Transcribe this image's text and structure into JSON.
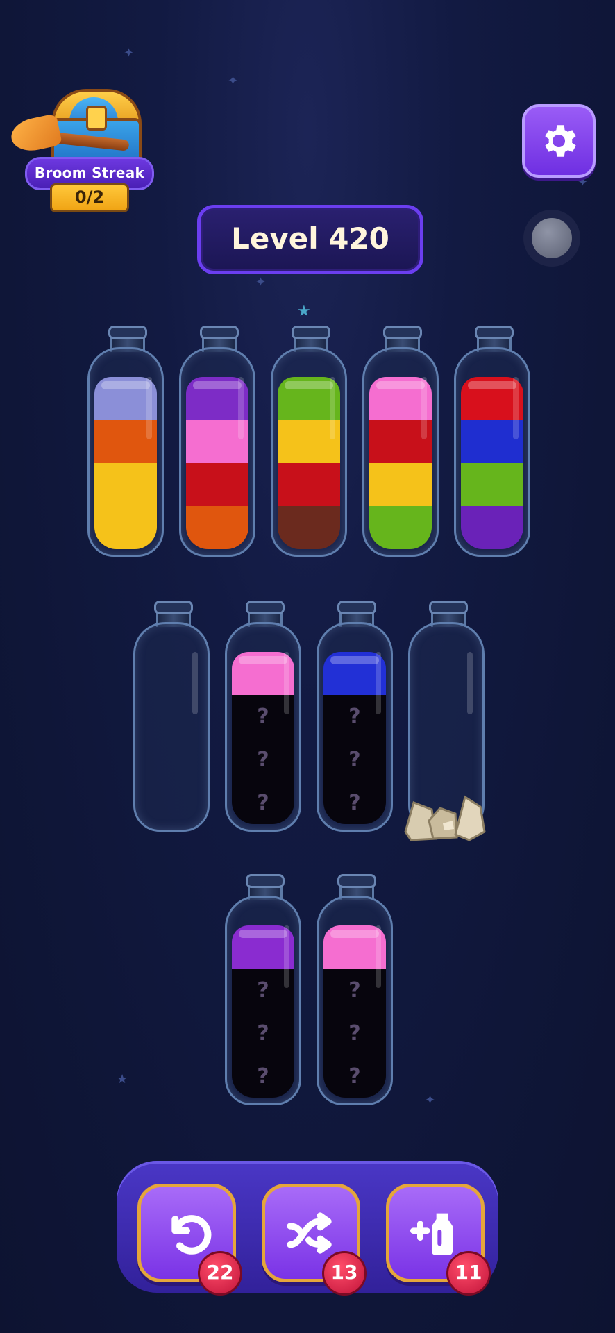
{
  "header": {
    "streak_label": "Broom Streak",
    "streak_count": "0/2",
    "settings_icon": "gear-icon",
    "record_icon": "record-icon",
    "level_text": "Level 420"
  },
  "tubes": [
    {
      "layers": [
        "#f5c21a",
        "#f5c21a",
        "#e0560e",
        "#8b8fd8"
      ],
      "hidden": 0
    },
    {
      "layers": [
        "#e0560e",
        "#c8101a",
        "#f56ed0",
        "#7d2cc6"
      ],
      "hidden": 0
    },
    {
      "layers": [
        "#6b2a1e",
        "#c8101a",
        "#f5c21a",
        "#66b51c"
      ],
      "hidden": 0
    },
    {
      "layers": [
        "#66b51c",
        "#f5c21a",
        "#c8101a",
        "#f56ed0"
      ],
      "hidden": 0
    },
    {
      "layers": [
        "#6a22b8",
        "#66b51c",
        "#1f2ed0",
        "#d8101c"
      ],
      "hidden": 0
    },
    {
      "layers": [],
      "hidden": 0
    },
    {
      "layers": [
        "#f56ed0"
      ],
      "hidden": 3
    },
    {
      "layers": [
        "#2230d6"
      ],
      "hidden": 3
    },
    {
      "layers": [],
      "hidden": 0
    },
    {
      "layers": [
        "#8a2cd0"
      ],
      "hidden": 3
    },
    {
      "layers": [
        "#f56ed0"
      ],
      "hidden": 3
    }
  ],
  "hidden_mark": "?",
  "powerups": {
    "undo": {
      "icon": "undo-icon",
      "count": "22"
    },
    "shuffle": {
      "icon": "shuffle-icon",
      "count": "13"
    },
    "add_tube": {
      "icon": "add-tube-icon",
      "count": "11"
    }
  },
  "colors": {
    "background": "#121a42",
    "button_purple": "#7a33e6",
    "button_border": "#e5a63a",
    "badge_red": "#c1143a"
  }
}
